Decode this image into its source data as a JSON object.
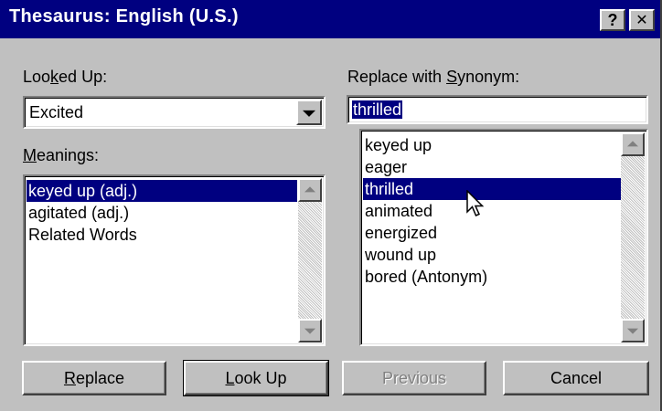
{
  "window": {
    "title": "Thesaurus: English (U.S.)",
    "help_button": "?",
    "close_button": "✕"
  },
  "looked_up": {
    "label_pre": "Loo",
    "label_mnemonic": "k",
    "label_post": "ed Up:",
    "value": "Excited"
  },
  "meanings": {
    "label_mnemonic": "M",
    "label_post": "eanings:",
    "items": [
      "keyed up (adj.)",
      "agitated (adj.)",
      "Related Words"
    ],
    "selected_index": 0
  },
  "replace_with": {
    "label_pre": "Replace with ",
    "label_mnemonic": "S",
    "label_post": "ynonym:",
    "value": "thrilled"
  },
  "synonyms": {
    "items": [
      "keyed up",
      "eager",
      "thrilled",
      "animated",
      "energized",
      "wound up",
      "bored (Antonym)"
    ],
    "selected_index": 2
  },
  "buttons": {
    "replace_mnemonic": "R",
    "replace_post": "eplace",
    "lookup_mnemonic": "L",
    "lookup_post": "ook Up",
    "previous": "Previous",
    "cancel": "Cancel"
  },
  "colors": {
    "face": "#c0c0c0",
    "titlebar": "#000080",
    "selection": "#000080"
  }
}
